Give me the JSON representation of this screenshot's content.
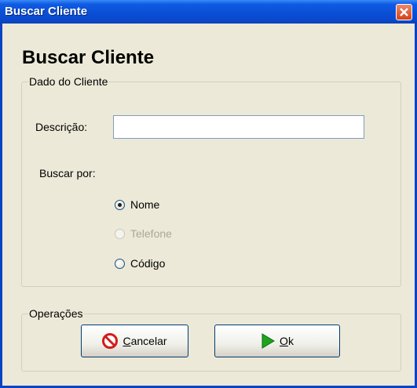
{
  "window": {
    "title": "Buscar Cliente"
  },
  "heading": "Buscar Cliente",
  "group_dados": {
    "legend": "Dado do Cliente",
    "descricao_label": "Descrição:",
    "descricao_value": "",
    "buscar_por_label": "Buscar por:",
    "options": [
      {
        "label": "Nome",
        "checked": true,
        "disabled": false
      },
      {
        "label": "Telefone",
        "checked": false,
        "disabled": true
      },
      {
        "label": "Código",
        "checked": false,
        "disabled": false
      }
    ]
  },
  "group_ops": {
    "legend": "Operações",
    "cancel_mnemonic": "C",
    "cancel_rest": "ancelar",
    "ok_mnemonic": "O",
    "ok_rest": "k"
  },
  "colors": {
    "titlebar": "#0A4FD6",
    "window_bg": "#ECE9D8",
    "close": "#D24218",
    "ok_icon": "#1EA31E",
    "cancel_icon": "#D41B1B"
  },
  "icons": {
    "close": "close-icon",
    "cancel": "no-entry-icon",
    "ok": "play-arrow-icon"
  }
}
